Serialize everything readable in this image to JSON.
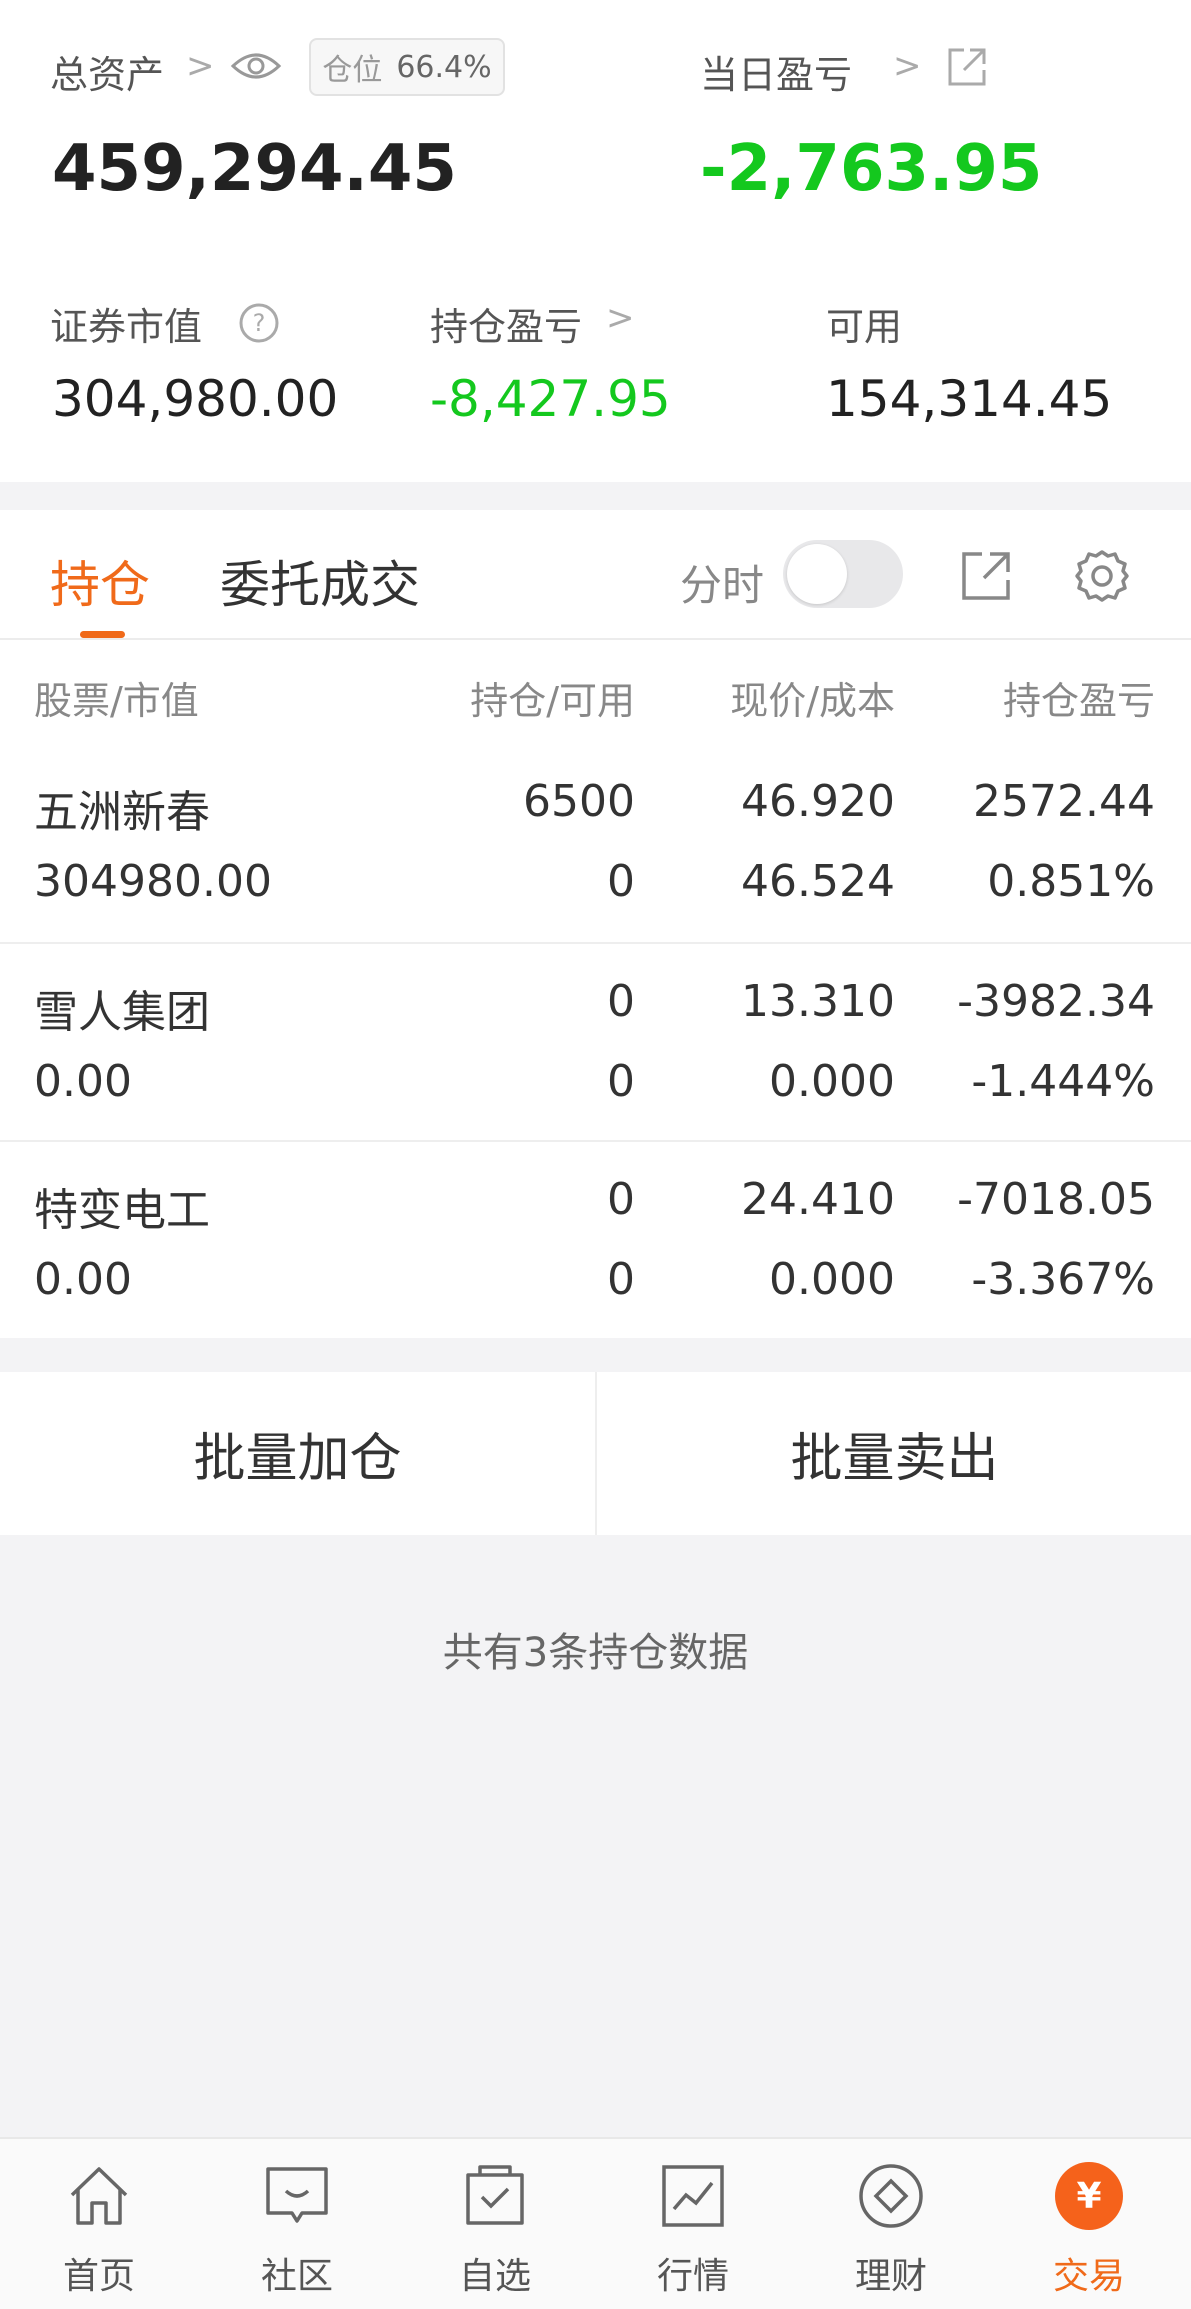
{
  "summary": {
    "total_assets_label": "总资产",
    "total_assets_value": "459,294.45",
    "position_label": "仓位",
    "position_value": "66.4%",
    "daily_pnl_label": "当日盈亏",
    "daily_pnl_value": "-2,763.95",
    "market_value_label": "证券市值",
    "market_value_value": "304,980.00",
    "holding_pnl_label": "持仓盈亏",
    "holding_pnl_value": "-8,427.95",
    "available_label": "可用",
    "available_value": "154,314.45"
  },
  "tabs": {
    "holdings": "持仓",
    "orders": "委托成交",
    "timeshare_label": "分时",
    "timeshare_on": false
  },
  "table": {
    "headers": {
      "stock": "股票/市值",
      "position": "持仓/可用",
      "price": "现价/成本",
      "pnl": "持仓盈亏"
    },
    "rows": [
      {
        "name": "五洲新春",
        "market_value": "304980.00",
        "position": "6500",
        "available": "0",
        "price": "46.920",
        "cost": "46.524",
        "pnl": "2572.44",
        "pnl_pct": "0.851%"
      },
      {
        "name": "雪人集团",
        "market_value": "0.00",
        "position": "0",
        "available": "0",
        "price": "13.310",
        "cost": "0.000",
        "pnl": "-3982.34",
        "pnl_pct": "-1.444%"
      },
      {
        "name": "特变电工",
        "market_value": "0.00",
        "position": "0",
        "available": "0",
        "price": "24.410",
        "cost": "0.000",
        "pnl": "-7018.05",
        "pnl_pct": "-3.367%"
      }
    ]
  },
  "batch": {
    "add": "批量加仓",
    "sell": "批量卖出"
  },
  "footer_note": "共有3条持仓数据",
  "nav": {
    "items": [
      {
        "label": "首页",
        "icon": "home-icon"
      },
      {
        "label": "社区",
        "icon": "community-icon"
      },
      {
        "label": "自选",
        "icon": "watchlist-icon"
      },
      {
        "label": "行情",
        "icon": "market-icon"
      },
      {
        "label": "理财",
        "icon": "wealth-icon"
      },
      {
        "label": "交易",
        "icon": "trade-icon"
      }
    ],
    "active": "交易"
  },
  "colors": {
    "accent": "#f06a1a",
    "up": "#d8152b",
    "down": "#14c81e"
  }
}
